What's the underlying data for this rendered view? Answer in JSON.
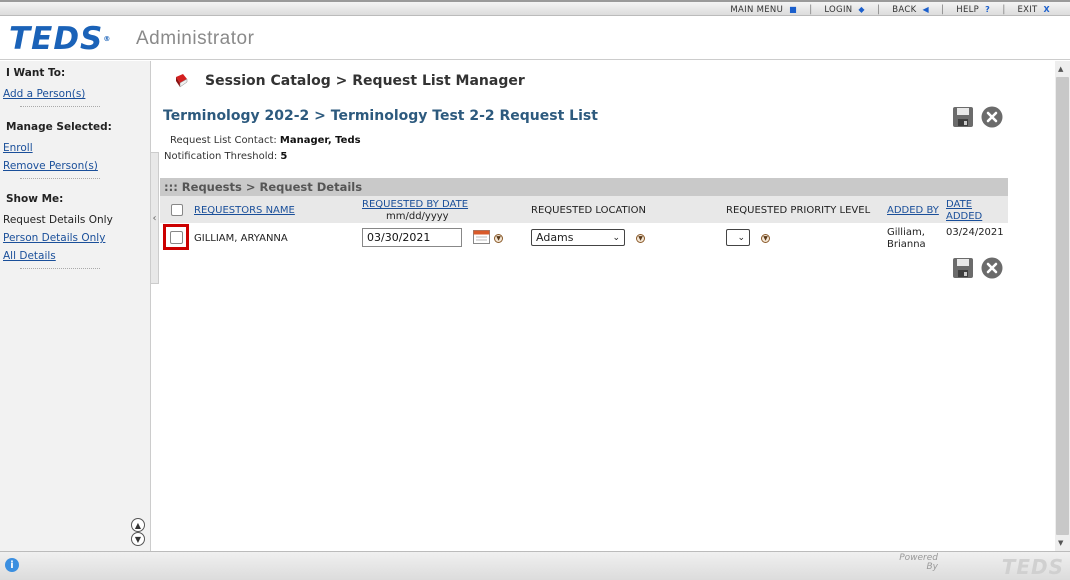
{
  "topnav": {
    "items": [
      {
        "label": "MAIN MENU",
        "glyph": "■"
      },
      {
        "label": "LOGIN",
        "glyph": "◆"
      },
      {
        "label": "BACK",
        "glyph": "◀"
      },
      {
        "label": "HELP",
        "glyph": "?"
      },
      {
        "label": "EXIT",
        "glyph": "X"
      }
    ]
  },
  "header": {
    "logo": "TEDS",
    "app_name": "Administrator"
  },
  "sidebar": {
    "i_want_to": "I Want To:",
    "add_person": "Add a Person(s)",
    "manage_selected": "Manage Selected:",
    "enroll": "Enroll",
    "remove_person": "Remove Person(s)",
    "show_me": "Show Me:",
    "request_details_only": "Request Details Only",
    "person_details_only": "Person Details Only",
    "all_details": "All Details"
  },
  "main": {
    "page_heading": "Session Catalog > Request List Manager",
    "list_title": "Terminology 202-2 > Terminology Test 2-2 Request List",
    "contact_label": "Request List Contact:",
    "contact_value": "Manager, Teds",
    "threshold_label": "Notification Threshold:",
    "threshold_value": "5",
    "requests_bar": "::: Requests > Request Details",
    "columns": {
      "requestors_name": "REQUESTORS NAME",
      "requested_by_date": "REQUESTED BY DATE",
      "date_format": "mm/dd/yyyy",
      "requested_location": "REQUESTED LOCATION",
      "requested_priority_level": "REQUESTED PRIORITY LEVEL",
      "added_by": "ADDED BY",
      "date_added_1": "DATE",
      "date_added_2": "ADDED"
    },
    "rows": [
      {
        "name": "GILLIAM, ARYANNA",
        "requested_date": "03/30/2021",
        "location": "Adams",
        "priority": "",
        "added_by_1": "Gilliam,",
        "added_by_2": "Brianna",
        "date_added": "03/24/2021"
      }
    ]
  },
  "footer": {
    "powered_by_1": "Powered",
    "powered_by_2": "By",
    "logo": "TEDS"
  },
  "colors": {
    "brand_blue": "#1a62b8",
    "link_blue": "#1a4f9a",
    "highlight_red": "#cc0000"
  }
}
